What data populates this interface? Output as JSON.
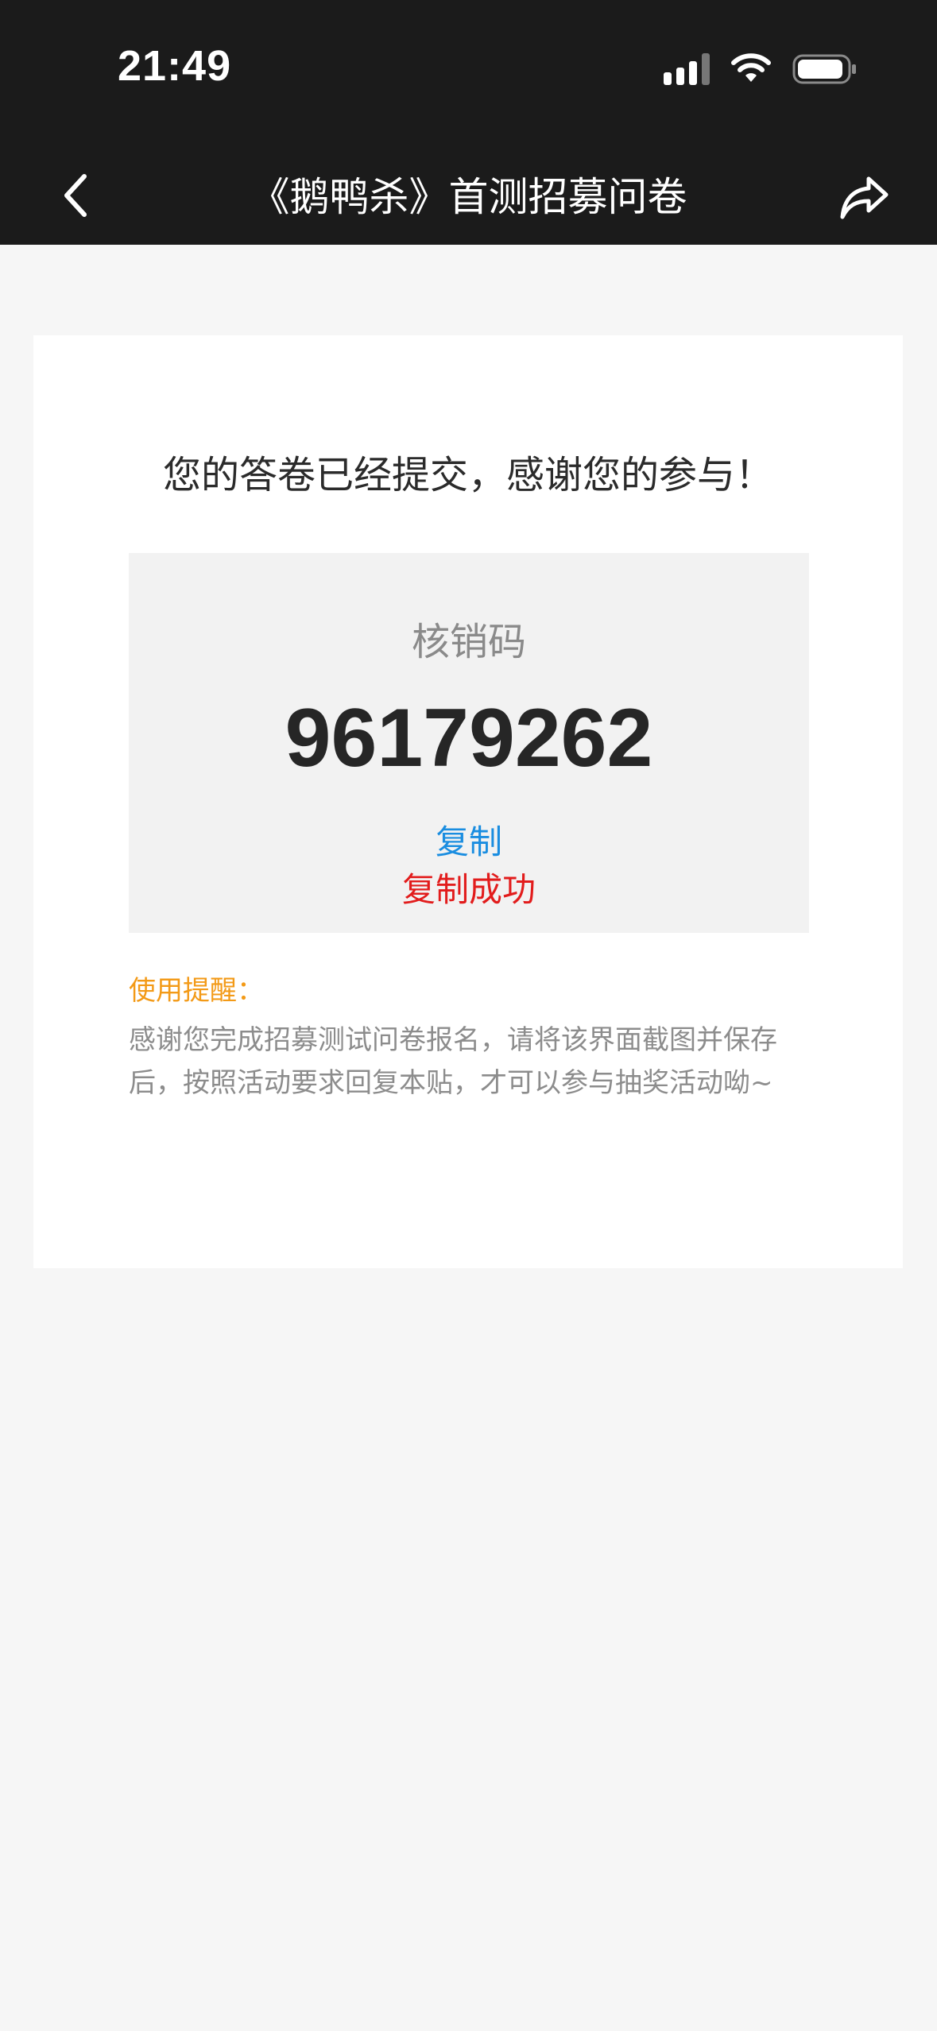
{
  "status_bar": {
    "time": "21:49"
  },
  "nav": {
    "title": "《鹅鸭杀》首测招募问卷",
    "back_icon": "chevron-left-icon",
    "share_icon": "share-arrow-icon"
  },
  "result": {
    "headline": "您的答卷已经提交，感谢您的参与！",
    "code_label": "核销码",
    "code_value": "96179262",
    "copy_label": "复制",
    "copy_success": "复制成功"
  },
  "tip": {
    "title": "使用提醒：",
    "body": "感谢您完成招募测试问卷报名，请将该界面截图并保存后，按照活动要求回复本贴，才可以参与抽奖活动呦~"
  },
  "colors": {
    "top_bar": "#1b1b1b",
    "page_bg": "#f6f6f6",
    "copy_blue": "#1a8de0",
    "success_red": "#e21c1c",
    "tip_orange": "#f39a17"
  }
}
